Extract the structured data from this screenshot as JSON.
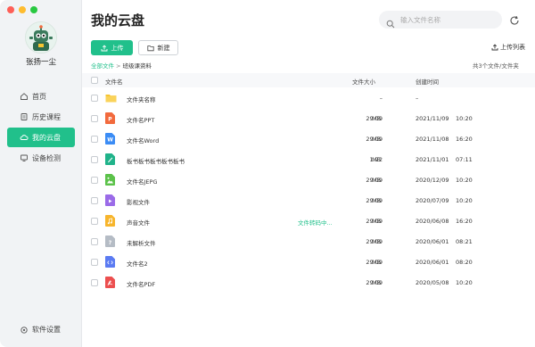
{
  "user": {
    "name": "张扬一尘"
  },
  "nav": [
    {
      "label": "首页",
      "icon": "home-icon",
      "active": false
    },
    {
      "label": "历史课程",
      "icon": "history-icon",
      "active": false
    },
    {
      "label": "我的云盘",
      "icon": "cloud-icon",
      "active": true
    },
    {
      "label": "设备检测",
      "icon": "device-icon",
      "active": false
    }
  ],
  "settings_label": "软件设置",
  "header": {
    "title": "我的云盘",
    "search_placeholder": "输入文件名称"
  },
  "toolbar": {
    "upload_label": "上传",
    "new_label": "新建",
    "upload_list_label": "上传列表"
  },
  "breadcrumb": {
    "root": "全部文件",
    "separator": ">",
    "current": "班级课资料"
  },
  "summary": "共3个文件/文件夹",
  "columns": {
    "name": "文件名",
    "size": "文件大小",
    "created": "创建时间"
  },
  "files": [
    {
      "name": "文件夹名称",
      "icon": "folder-icon",
      "color": "#f7c531",
      "status": "",
      "size": "–",
      "unit": "",
      "date": "–",
      "time": ""
    },
    {
      "name": "文件名PPT",
      "icon": "ppt-file-icon",
      "color": "#f26a3d",
      "status": "",
      "size": "29.09",
      "unit": "MB",
      "date": "2021/11/09",
      "time": "10:20"
    },
    {
      "name": "文件名Word",
      "icon": "word-file-icon",
      "color": "#3b8cf5",
      "status": "",
      "size": "29.09",
      "unit": "MB",
      "date": "2021/11/08",
      "time": "16:20"
    },
    {
      "name": "板书板书板书板书板书",
      "icon": "blackboard-file-icon",
      "color": "#20b38a",
      "status": "",
      "size": "1.22",
      "unit": "MB",
      "date": "2021/11/01",
      "time": "07:11"
    },
    {
      "name": "文件名JEPG",
      "icon": "image-file-icon",
      "color": "#5cc24a",
      "status": "",
      "size": "29.09",
      "unit": "MB",
      "date": "2020/12/09",
      "time": "10:20"
    },
    {
      "name": "影视文件",
      "icon": "video-file-icon",
      "color": "#9b6be8",
      "status": "",
      "size": "29.09",
      "unit": "MB",
      "date": "2020/07/09",
      "time": "10:20"
    },
    {
      "name": "声音文件",
      "icon": "audio-file-icon",
      "color": "#f7b52c",
      "status": "文件转码中...",
      "size": "29.09",
      "unit": "MB",
      "date": "2020/06/08",
      "time": "16:20"
    },
    {
      "name": "未解析文件",
      "icon": "unknown-file-icon",
      "color": "#b5bcc5",
      "status": "",
      "size": "29.09",
      "unit": "MB",
      "date": "2020/06/01",
      "time": "08:21"
    },
    {
      "name": "文件名2",
      "icon": "code-file-icon",
      "color": "#5b7bf2",
      "status": "",
      "size": "29.09",
      "unit": "MB",
      "date": "2020/06/01",
      "time": "08:20"
    },
    {
      "name": "文件名PDF",
      "icon": "pdf-file-icon",
      "color": "#ec4f4f",
      "status": "",
      "size": "29.09",
      "unit": "MB",
      "date": "2020/05/08",
      "time": "10:20"
    }
  ],
  "colors": {
    "accent": "#21c08b",
    "sidebar_bg": "#f1f3f5"
  }
}
